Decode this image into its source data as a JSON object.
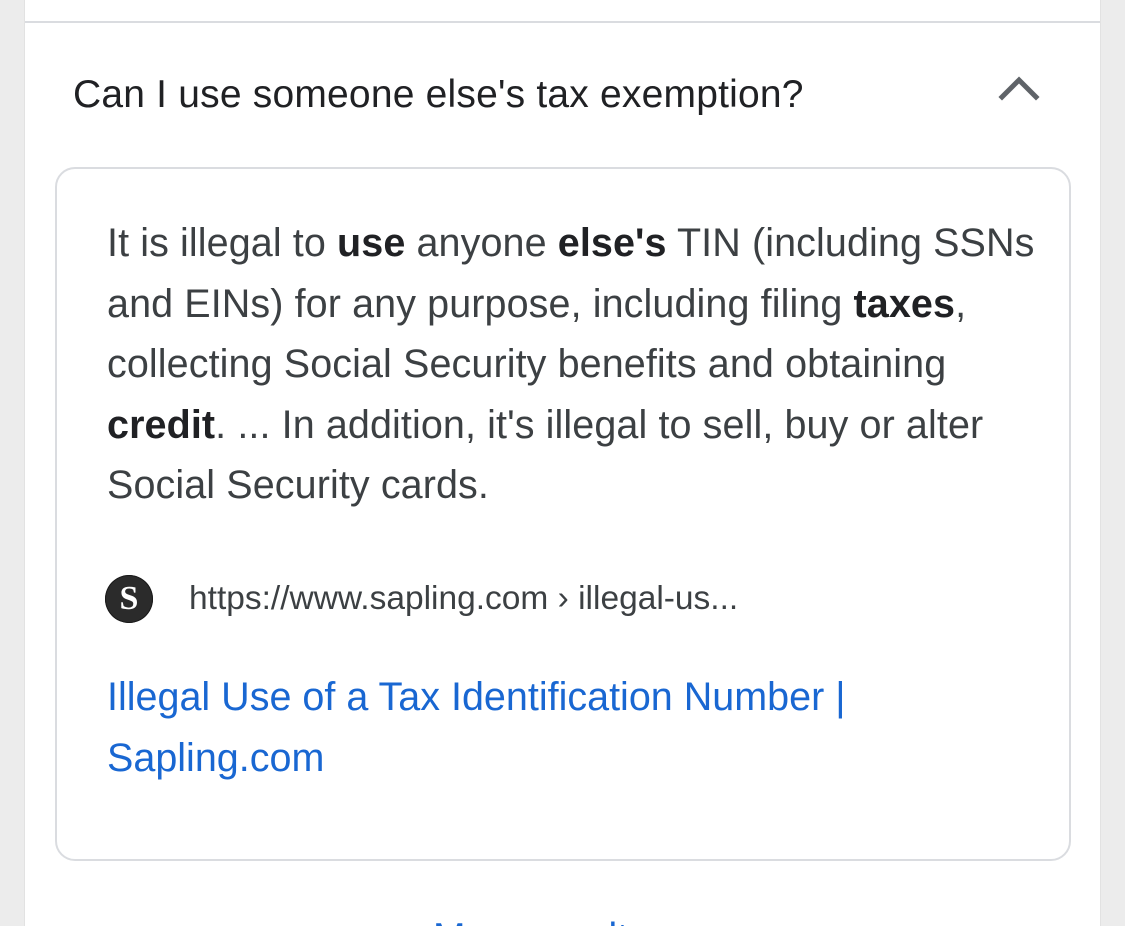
{
  "faq": {
    "question": "Can I use someone else's tax exemption?",
    "expanded_icon": "chevron-up-icon",
    "answer": {
      "segments": [
        {
          "text": "It is illegal to ",
          "bold": false
        },
        {
          "text": "use",
          "bold": true
        },
        {
          "text": " anyone ",
          "bold": false
        },
        {
          "text": "else's",
          "bold": true
        },
        {
          "text": " TIN (including SSNs and EINs) for any purpose, including filing ",
          "bold": false
        },
        {
          "text": "taxes",
          "bold": true
        },
        {
          "text": ", collecting Social Security benefits and obtaining ",
          "bold": false
        },
        {
          "text": "credit",
          "bold": true
        },
        {
          "text": ". ... In addition, it's illegal to sell, buy or alter Social Security cards.",
          "bold": false
        }
      ]
    },
    "source": {
      "favicon_letter": "S",
      "url": "https://www.sapling.com › illegal-us..."
    },
    "link_title": "Illegal Use of a Tax Identification Number | Sapling.com"
  },
  "more_results": {
    "label": "More results"
  },
  "colors": {
    "link": "#1967d2",
    "text": "#3c4043",
    "border": "#dadce0"
  }
}
